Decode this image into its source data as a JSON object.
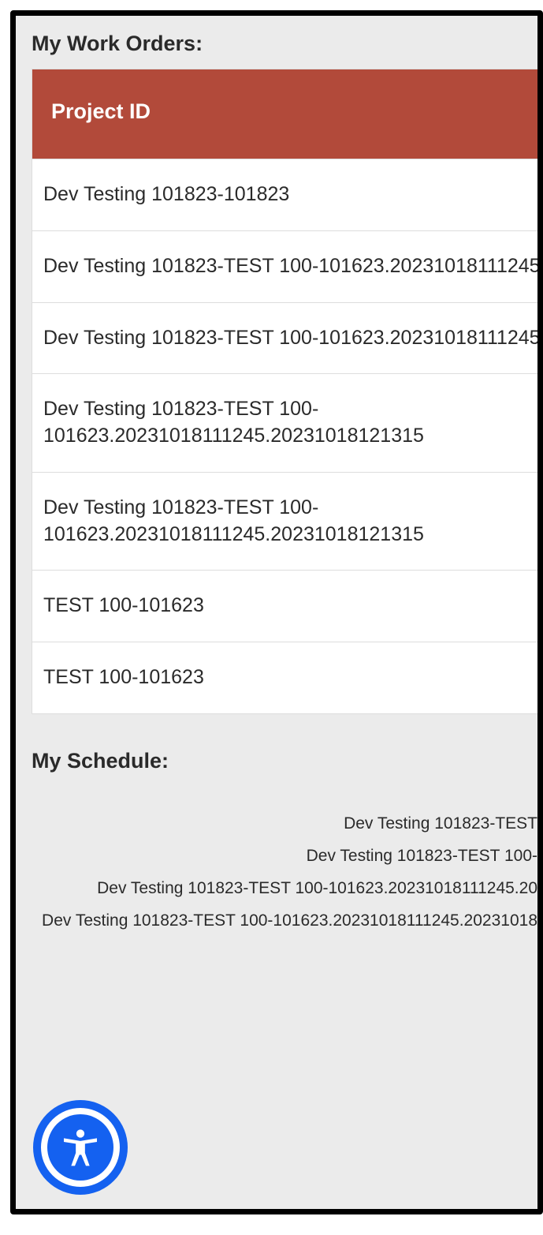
{
  "work_orders": {
    "title": "My Work Orders:",
    "column_header": "Project ID",
    "rows": [
      "Dev Testing 101823-101823",
      "Dev Testing 101823-TEST 100-101623.20231018111245",
      "Dev Testing 101823-TEST 100-101623.20231018111245",
      "Dev Testing 101823-TEST 100-101623.20231018111245.20231018121315",
      "Dev Testing 101823-TEST 100-101623.20231018111245.20231018121315",
      "TEST 100-101623",
      "TEST 100-101623"
    ]
  },
  "schedule": {
    "title": "My Schedule:",
    "items": [
      "Dev Testing 101823-TEST",
      "Dev Testing 101823-TEST 100-",
      "Dev Testing 101823-TEST 100-101623.20231018111245.20",
      "Dev Testing 101823-TEST 100-101623.20231018111245.20231018"
    ]
  }
}
